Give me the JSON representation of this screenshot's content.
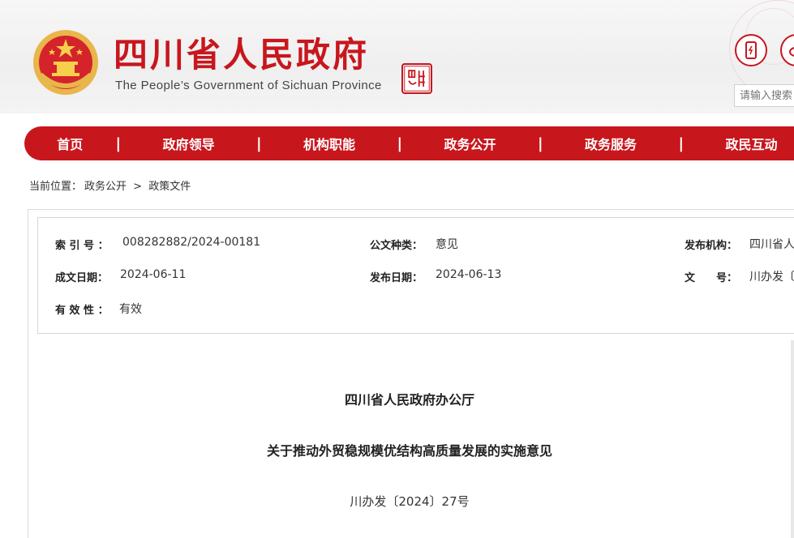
{
  "header": {
    "title_cn": "四川省人民政府",
    "title_en": "The People’s Government of Sichuan Province",
    "seal_text": "四川中國",
    "search_placeholder": "请输入搜索"
  },
  "nav": {
    "items": [
      {
        "label": "首页"
      },
      {
        "label": "政府领导"
      },
      {
        "label": "机构职能"
      },
      {
        "label": "政务公开"
      },
      {
        "label": "政务服务"
      },
      {
        "label": "政民互动"
      }
    ],
    "separator": "|"
  },
  "breadcrumb": {
    "prefix": "当前位置：",
    "items": [
      "政务公开",
      "政策文件"
    ],
    "separator": ">"
  },
  "meta": {
    "index_label": "索 引 号 ：",
    "index_value": "008282882/2024-00181",
    "doc_type_label": "公文种类：",
    "doc_type_value": "意见",
    "publisher_label": "发布机构：",
    "publisher_value": "四川省人",
    "created_label": "成文日期：",
    "created_value": "2024-06-11",
    "published_label": "发布日期：",
    "published_value": "2024-06-13",
    "docno_label": "文　　号：",
    "docno_value": "川办发〔",
    "validity_label": "有 效 性 ：",
    "validity_value": "有效"
  },
  "document": {
    "issuer": "四川省人民政府办公厅",
    "title": "关于推动外贸稳规模优结构高质量发展的实施意见",
    "number": "川办发〔2024〕27号"
  },
  "colors": {
    "brand_red": "#c8161d"
  }
}
